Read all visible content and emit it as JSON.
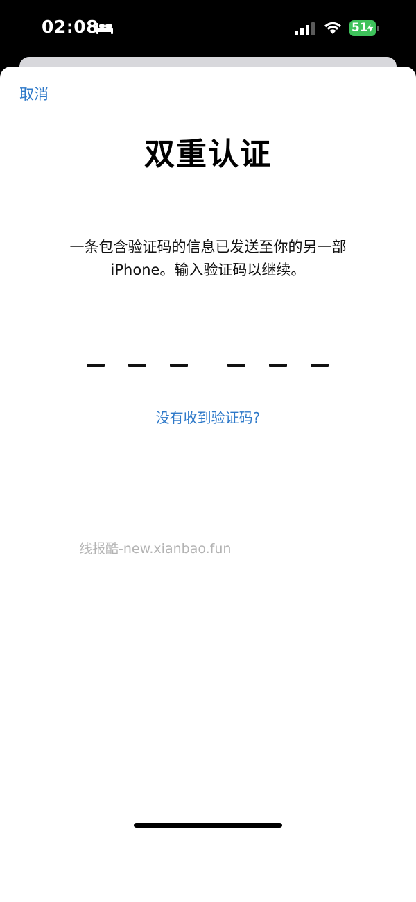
{
  "status_bar": {
    "time": "02:08",
    "battery_level": "51",
    "icons": [
      "bed-icon",
      "signal-icon",
      "wifi-icon",
      "charging-bolt-icon"
    ],
    "battery_color": "#3ec25b"
  },
  "sheet": {
    "cancel_label": "取消",
    "title": "双重认证",
    "description": "一条包含验证码的信息已发送至你的另一部iPhone。输入验证码以继续。",
    "code": {
      "length": 6,
      "digits": [
        "",
        "",
        "",
        "",
        "",
        ""
      ]
    },
    "resend_label": "没有收到验证码?",
    "watermark": "线报酷-new.xianbao.fun",
    "accent_color": "#2e79c9"
  }
}
